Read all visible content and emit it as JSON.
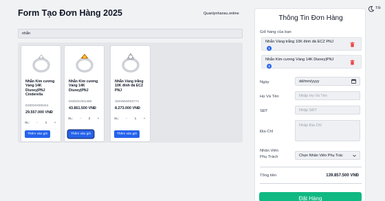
{
  "header": {
    "title": "Form Tạo Đơn Hàng 2025",
    "site": "Quanlynhansu.online"
  },
  "search": {
    "value": "nhẫn"
  },
  "products": [
    {
      "name": "Nhẫn Kim cương Vàng 14K Disney|PNJ Cinderella",
      "code": "DDDDH000344",
      "price": "29.557.000 VNĐ",
      "qty_label": "SL:",
      "qty": "1",
      "add_label": "Thêm vào giỏ",
      "image": "ring-icon"
    },
    {
      "name": "Nhẫn Kim cương Vàng 14K Disney|PNJ",
      "code": "DDDDC001480",
      "price": "43.861.500 VNĐ",
      "qty_label": "SL:",
      "qty": "2",
      "add_label": "Thêm vào giỏ",
      "image": "ring-icon"
    },
    {
      "name": "Nhẫn Vàng trắng 10K đính đá ECZ PNJ",
      "code": "XMXMW003774",
      "price": "8.273.000 VNĐ",
      "qty_label": "SL:",
      "qty": "1",
      "add_label": "Thêm vào giỏ",
      "image": "ring-icon"
    }
  ],
  "qty_controls": {
    "minus": "-",
    "plus": "+"
  },
  "order": {
    "title": "Thông Tin Đơn Hàng",
    "cart_label": "Giỏ hàng của bạn",
    "cart": [
      {
        "name": "Nhẫn Vàng trắng 10K đính đá ECZ PNJ",
        "qty": "1"
      },
      {
        "name": "Nhẫn Kim cương Vàng 14K Disney|PNJ",
        "qty": "2"
      }
    ],
    "date_label": "Ngày",
    "date_value": "dd/mm/yyyy",
    "name_label": "Họ Và Tên",
    "name_placeholder": "Nhập Họ Và Tên",
    "phone_label": "SĐT",
    "phone_placeholder": "Nhập SĐT",
    "address_label": "Địa Chỉ",
    "address_placeholder": "Nhập Địa Chỉ",
    "staff_label_1": "Nhân Viên",
    "staff_label_2": "Phụ Trách",
    "staff_select": "Chọn Nhân Viên Phụ Trác",
    "total_label": "Tổng tiền",
    "total_value": "139.857.500 VNĐ",
    "submit_label": "Đặt Hàng"
  },
  "theme": {
    "label": "Tối",
    "icon": "moon-icon"
  },
  "colors": {
    "primary": "#2563eb",
    "success": "#10b981",
    "danger": "#ef4444"
  }
}
